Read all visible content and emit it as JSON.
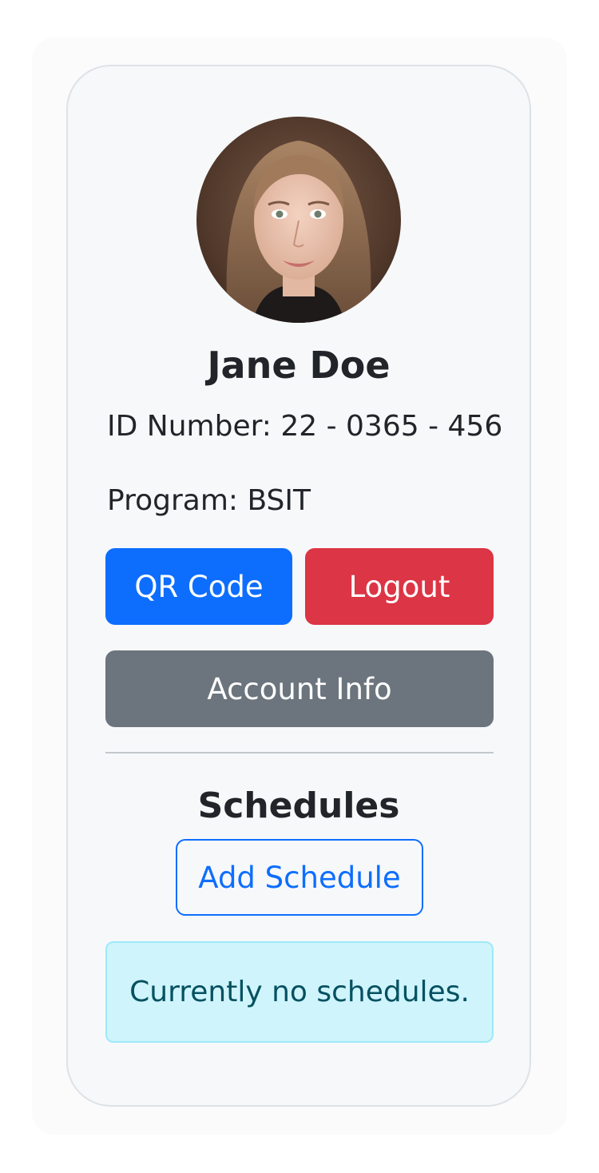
{
  "profile": {
    "name": "Jane Doe",
    "id_number": "ID Number: 22 - 0365 - 456",
    "program": "Program: BSIT"
  },
  "actions": {
    "qr_code_label": "QR Code",
    "logout_label": "Logout",
    "account_info_label": "Account Info"
  },
  "schedules": {
    "title": "Schedules",
    "add_label": "Add Schedule",
    "empty_message": "Currently no schedules."
  },
  "colors": {
    "primary": "#0d6efd",
    "danger": "#dc3545",
    "secondary": "#6c757d",
    "info_bg": "#cff4fc",
    "info_text": "#055160"
  }
}
